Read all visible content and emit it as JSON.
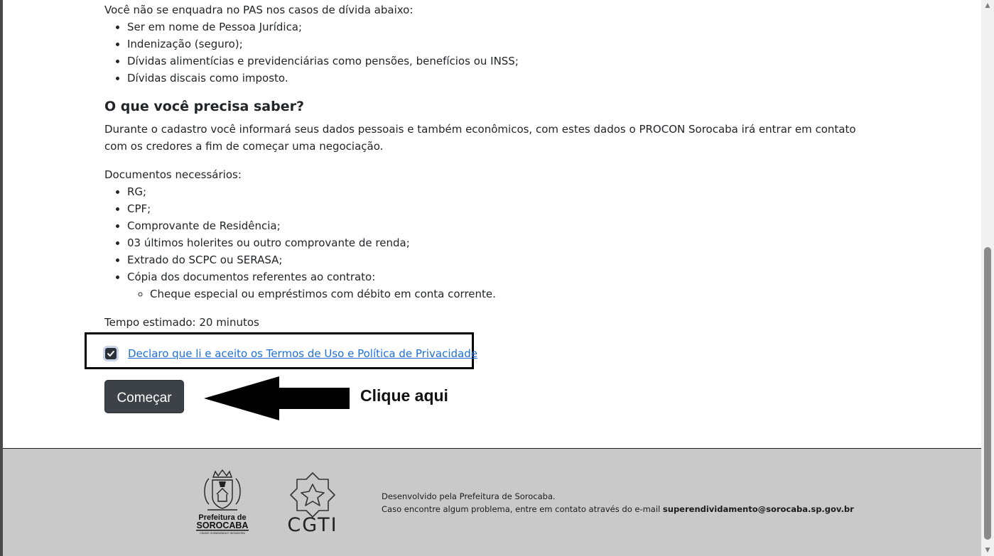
{
  "content": {
    "intro": "Você não se enquadra no PAS nos casos de dívida abaixo:",
    "excluded_debts": [
      "Ser em nome de Pessoa Jurídica;",
      "Indenização (seguro);",
      "Dívidas alimentícias e previdenciárias como pensões, benefícios ou INSS;",
      "Dívidas discais como imposto."
    ],
    "section_title": "O que você precisa saber?",
    "description": "Durante o cadastro você informará seus dados pessoais e também econômicos, com estes dados o PROCON Sorocaba irá entrar em contato com os credores a fim de começar uma negociação.",
    "docs_label": "Documentos necessários:",
    "documents": [
      "RG;",
      "CPF;",
      "Comprovante de Residência;",
      "03 últimos holerites ou outro comprovante de renda;",
      "Extrado do SCPC ou SERASA;",
      "Cópia dos documentos referentes ao contrato:"
    ],
    "sub_document": "Cheque especial ou empréstimos com débito em conta corrente.",
    "estimated_time": "Tempo estimado: 20 minutos"
  },
  "terms": {
    "checked": true,
    "label": "Declaro que li e aceito os Termos de Uso e Política de Privacidade"
  },
  "start_button": "Começar",
  "annotation": {
    "hint": "Clique aqui"
  },
  "footer": {
    "logo_pref_line1": "Prefeitura de",
    "logo_pref_line2": "SOROCABA",
    "logo_pref_tagline": "CIDADE HUMANIZADA E INOVADORA",
    "logo_cgti": "CGTI",
    "line1": "Desenvolvido pela Prefeitura de Sorocaba.",
    "line2_prefix": "Caso encontre algum problema, entre em contato através do e-mail ",
    "email": "superendividamento@sorocaba.sp.gov.br"
  },
  "colors": {
    "link": "#1f6fd6",
    "button": "#3c4247",
    "footer_bg": "#c9c9c9"
  }
}
